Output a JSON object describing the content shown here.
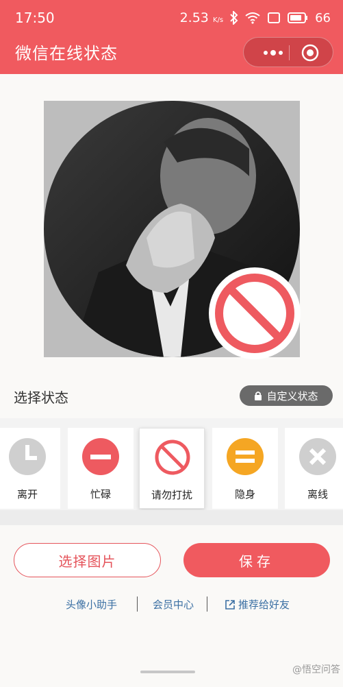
{
  "status_bar": {
    "time": "17:50",
    "speed": "2.53",
    "speed_unit": "K/s",
    "battery": "66"
  },
  "header": {
    "title": "微信在线状态"
  },
  "status_section": {
    "title": "选择状态",
    "custom_button": "自定义状态"
  },
  "status_options": [
    {
      "label": "离开",
      "icon": "clock-icon",
      "color": "#cfcfcf"
    },
    {
      "label": "忙碌",
      "icon": "minus-icon",
      "color": "#ee5a60"
    },
    {
      "label": "请勿打扰",
      "icon": "ban-icon",
      "color": "#ee5a60"
    },
    {
      "label": "隐身",
      "icon": "equal-icon",
      "color": "#f5a623"
    },
    {
      "label": "离线",
      "icon": "x-icon",
      "color": "#cfcfcf"
    }
  ],
  "selected_option": "请勿打扰",
  "actions": {
    "select_image": "选择图片",
    "save": "保存"
  },
  "footer_links": [
    {
      "label": "头像小助手"
    },
    {
      "label": "会员中心"
    },
    {
      "label": "推荐给好友",
      "icon": "external-link-icon"
    }
  ],
  "watermark": "@悟空问答",
  "colors": {
    "brand": "#f05a5f",
    "link": "#3a6fa3"
  }
}
